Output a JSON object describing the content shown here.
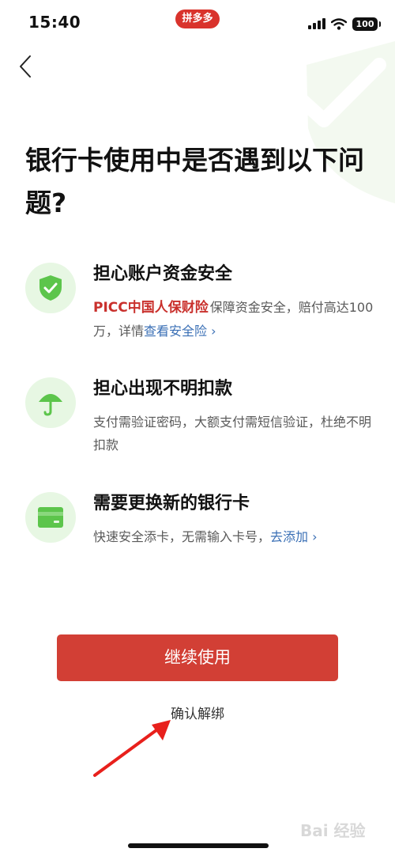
{
  "status_bar": {
    "time": "15:40",
    "app_badge": "拼多多",
    "battery": "100"
  },
  "nav": {
    "back_icon": "chevron-left-icon"
  },
  "page": {
    "title": "银行卡使用中是否遇到以下问题?"
  },
  "features": [
    {
      "icon": "shield-check-icon",
      "title": "担心账户资金安全",
      "brand": "PICC中国人保财险",
      "desc": "保障资金安全，赔付高达100万，详情",
      "link": "查看安全险"
    },
    {
      "icon": "umbrella-icon",
      "title": "担心出现不明扣款",
      "desc": "支付需验证密码，大额支付需短信验证，杜绝不明扣款"
    },
    {
      "icon": "card-icon",
      "title": "需要更换新的银行卡",
      "desc": "快速安全添卡，无需输入卡号，",
      "link": "去添加"
    }
  ],
  "actions": {
    "continue_label": "继续使用",
    "unbind_label": "确认解绑"
  },
  "watermark": {
    "text": "Bai 经验"
  },
  "colors": {
    "primary": "#d23f35",
    "accent_green": "#5cc54b",
    "icon_bg": "#e7f7e3",
    "link": "#3a6fb5"
  }
}
